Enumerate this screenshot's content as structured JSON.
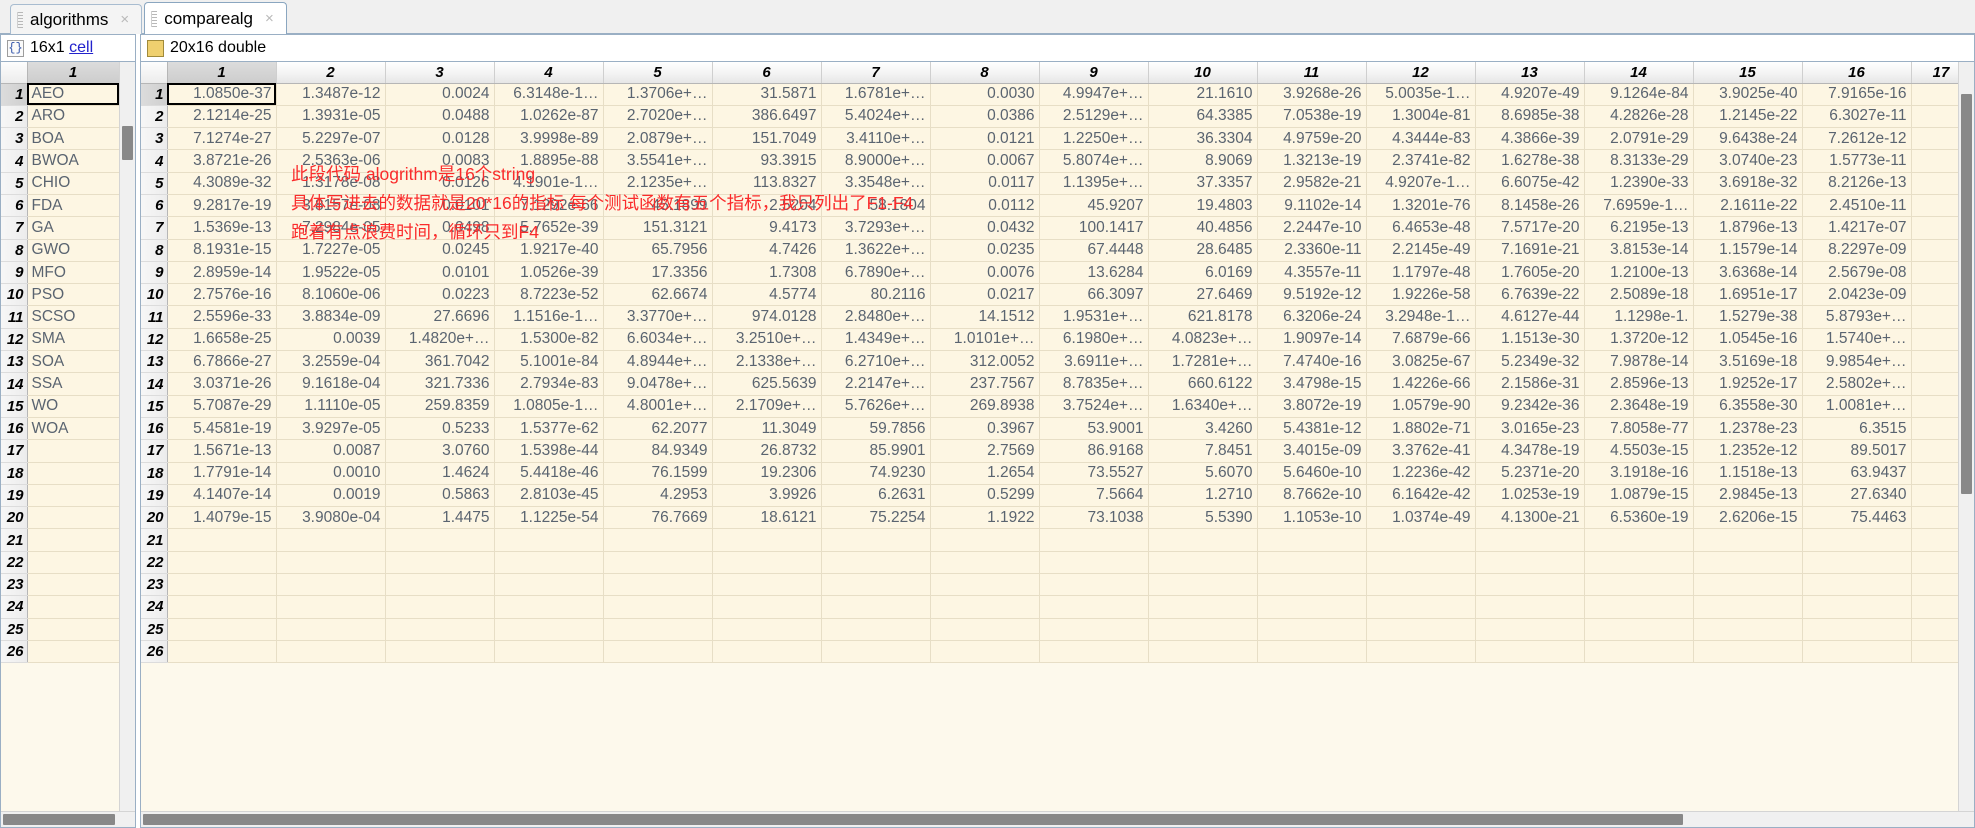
{
  "window": {
    "tabs": [
      {
        "label": "algorithms",
        "active": false,
        "close_icon": "×"
      },
      {
        "label": "comparealg",
        "active": true,
        "close_icon": "×"
      }
    ]
  },
  "left_panel": {
    "icon": "cell-array-icon",
    "icon_glyph": "{}",
    "size_text": "16x1",
    "type_link": "cell",
    "column_header": "1",
    "row_headers": [
      "1",
      "2",
      "3",
      "4",
      "5",
      "6",
      "7",
      "8",
      "9",
      "10",
      "11",
      "12",
      "13",
      "14",
      "15",
      "16",
      "17",
      "18",
      "19",
      "20",
      "21",
      "22",
      "23",
      "24",
      "25",
      "26"
    ],
    "values": [
      "AEO",
      "ARO",
      "BOA",
      "BWOA",
      "CHIO",
      "FDA",
      "GA",
      "GWO",
      "MFO",
      "PSO",
      "SCSO",
      "SMA",
      "SOA",
      "SSA",
      "WO",
      "WOA",
      "",
      "",
      "",
      "",
      "",
      "",
      "",
      "",
      "",
      ""
    ],
    "selected_row": 1,
    "selected_col": 1
  },
  "right_panel": {
    "icon": "matrix-icon",
    "size_text": "20x16 double",
    "column_headers": [
      "1",
      "2",
      "3",
      "4",
      "5",
      "6",
      "7",
      "8",
      "9",
      "10",
      "11",
      "12",
      "13",
      "14",
      "15",
      "16",
      "17"
    ],
    "row_headers": [
      "1",
      "2",
      "3",
      "4",
      "5",
      "6",
      "7",
      "8",
      "9",
      "10",
      "11",
      "12",
      "13",
      "14",
      "15",
      "16",
      "17",
      "18",
      "19",
      "20",
      "21",
      "22",
      "23",
      "24",
      "25",
      "26"
    ],
    "selected_row": 1,
    "selected_col": 1,
    "rows": [
      [
        "1.0850e-37",
        "1.3487e-12",
        "0.0024",
        "6.3148e-1…",
        "1.3706e+…",
        "31.5871",
        "1.6781e+…",
        "0.0030",
        "4.9947e+…",
        "21.1610",
        "3.9268e-26",
        "5.0035e-1…",
        "4.9207e-49",
        "9.1264e-84",
        "3.9025e-40",
        "7.9165e-16",
        ""
      ],
      [
        "2.1214e-25",
        "1.3931e-05",
        "0.0488",
        "1.0262e-87",
        "2.7020e+…",
        "386.6497",
        "5.4024e+…",
        "0.0386",
        "2.5129e+…",
        "64.3385",
        "7.0538e-19",
        "1.3004e-81",
        "8.6985e-38",
        "4.2826e-28",
        "1.2145e-22",
        "6.3027e-11",
        ""
      ],
      [
        "7.1274e-27",
        "5.2297e-07",
        "0.0128",
        "3.9998e-89",
        "2.0879e+…",
        "151.7049",
        "3.4110e+…",
        "0.0121",
        "1.2250e+…",
        "36.3304",
        "4.9759e-20",
        "4.3444e-83",
        "4.3866e-39",
        "2.0791e-29",
        "9.6438e-24",
        "7.2612e-12",
        ""
      ],
      [
        "3.8721e-26",
        "2.5363e-06",
        "0.0083",
        "1.8895e-88",
        "3.5541e+…",
        "93.3915",
        "8.9000e+…",
        "0.0067",
        "5.8074e+…",
        "8.9069",
        "1.3213e-19",
        "2.3741e-82",
        "1.6278e-38",
        "8.3133e-29",
        "3.0740e-23",
        "1.5773e-11",
        ""
      ],
      [
        "4.3089e-32",
        "1.3178e-08",
        "0.0126",
        "4.1901e-1…",
        "2.1235e+…",
        "113.8327",
        "3.3548e+…",
        "0.0117",
        "1.1395e+…",
        "37.3357",
        "2.9582e-21",
        "4.9207e-1…",
        "6.6075e-42",
        "1.2390e-33",
        "3.6918e-32",
        "8.2126e-13",
        ""
      ],
      [
        "9.2817e-19",
        "3.8157e-08",
        "0.0101",
        "7.1292e-66",
        "45.1899",
        "2.5204",
        "58.1804",
        "0.0112",
        "45.9207",
        "19.4803",
        "9.1102e-14",
        "1.3201e-76",
        "8.1458e-26",
        "7.6959e-1…",
        "2.1611e-22",
        "2.4510e-11",
        ""
      ],
      [
        "1.5369e-13",
        "7.2984e-05",
        "0.0498",
        "5.7652e-39",
        "151.3121",
        "9.4173",
        "3.7293e+…",
        "0.0432",
        "100.1417",
        "40.4856",
        "2.2447e-10",
        "6.4653e-48",
        "7.5717e-20",
        "6.2195e-13",
        "1.8796e-13",
        "1.4217e-07",
        ""
      ],
      [
        "8.1931e-15",
        "1.7227e-05",
        "0.0245",
        "1.9217e-40",
        "65.7956",
        "4.7426",
        "1.3622e+…",
        "0.0235",
        "67.4448",
        "28.6485",
        "2.3360e-11",
        "2.2145e-49",
        "7.1691e-21",
        "3.8153e-14",
        "1.1579e-14",
        "8.2297e-09",
        ""
      ],
      [
        "2.8959e-14",
        "1.9522e-05",
        "0.0101",
        "1.0526e-39",
        "17.3356",
        "1.7308",
        "6.7890e+…",
        "0.0076",
        "13.6284",
        "6.0169",
        "4.3557e-11",
        "1.1797e-48",
        "1.7605e-20",
        "1.2100e-13",
        "3.6368e-14",
        "2.5679e-08",
        ""
      ],
      [
        "2.7576e-16",
        "8.1060e-06",
        "0.0223",
        "8.7223e-52",
        "62.6674",
        "4.5774",
        "80.2116",
        "0.0217",
        "66.3097",
        "27.6469",
        "9.5192e-12",
        "1.9226e-58",
        "6.7639e-22",
        "2.5089e-18",
        "1.6951e-17",
        "2.0423e-09",
        ""
      ],
      [
        "2.5596e-33",
        "3.8834e-09",
        "27.6696",
        "1.1516e-1…",
        "3.3770e+…",
        "974.0128",
        "2.8480e+…",
        "14.1512",
        "1.9531e+…",
        "621.8178",
        "6.3206e-24",
        "3.2948e-1…",
        "4.6127e-44",
        "1.1298e-1.",
        "1.5279e-38",
        "5.8793e+…",
        ""
      ],
      [
        "1.6658e-25",
        "0.0039",
        "1.4820e+…",
        "1.5300e-82",
        "6.6034e+…",
        "3.2510e+…",
        "1.4349e+…",
        "1.0101e+…",
        "6.1980e+…",
        "4.0823e+…",
        "1.9097e-14",
        "7.6879e-66",
        "1.1513e-30",
        "1.3720e-12",
        "1.0545e-16",
        "1.5740e+…",
        ""
      ],
      [
        "6.7866e-27",
        "3.2559e-04",
        "361.7042",
        "5.1001e-84",
        "4.8944e+…",
        "2.1338e+…",
        "6.2710e+…",
        "312.0052",
        "3.6911e+…",
        "1.7281e+…",
        "7.4740e-16",
        "3.0825e-67",
        "5.2349e-32",
        "7.9878e-14",
        "3.5169e-18",
        "9.9854e+…",
        ""
      ],
      [
        "3.0371e-26",
        "9.1618e-04",
        "321.7336",
        "2.7934e-83",
        "9.0478e+…",
        "625.5639",
        "2.2147e+…",
        "237.7567",
        "8.7835e+…",
        "660.6122",
        "3.4798e-15",
        "1.4226e-66",
        "2.1586e-31",
        "2.8596e-13",
        "1.9252e-17",
        "2.5802e+…",
        ""
      ],
      [
        "5.7087e-29",
        "1.1110e-05",
        "259.8359",
        "1.0805e-1…",
        "4.8001e+…",
        "2.1709e+…",
        "5.7626e+…",
        "269.8938",
        "3.7524e+…",
        "1.6340e+…",
        "3.8072e-19",
        "1.0579e-90",
        "9.2342e-36",
        "2.3648e-19",
        "6.3558e-30",
        "1.0081e+…",
        ""
      ],
      [
        "5.4581e-19",
        "3.9297e-05",
        "0.5233",
        "1.5377e-62",
        "62.2077",
        "11.3049",
        "59.7856",
        "0.3967",
        "53.9001",
        "3.4260",
        "5.4381e-12",
        "1.8802e-71",
        "3.0165e-23",
        "7.8058e-77",
        "1.2378e-23",
        "6.3515",
        ""
      ],
      [
        "1.5671e-13",
        "0.0087",
        "3.0760",
        "1.5398e-44",
        "84.9349",
        "26.8732",
        "85.9901",
        "2.7569",
        "86.9168",
        "7.8451",
        "3.4015e-09",
        "3.3762e-41",
        "4.3478e-19",
        "4.5503e-15",
        "1.2352e-12",
        "89.5017",
        ""
      ],
      [
        "1.7791e-14",
        "0.0010",
        "1.4624",
        "5.4418e-46",
        "76.1599",
        "19.2306",
        "74.9230",
        "1.2654",
        "73.5527",
        "5.6070",
        "5.6460e-10",
        "1.2236e-42",
        "5.2371e-20",
        "3.1918e-16",
        "1.1518e-13",
        "63.9437",
        ""
      ],
      [
        "4.1407e-14",
        "0.0019",
        "0.5863",
        "2.8103e-45",
        "4.2953",
        "3.9926",
        "6.2631",
        "0.5299",
        "7.5664",
        "1.2710",
        "8.7662e-10",
        "6.1642e-42",
        "1.0253e-19",
        "1.0879e-15",
        "2.9845e-13",
        "27.6340",
        ""
      ],
      [
        "1.4079e-15",
        "3.9080e-04",
        "1.4475",
        "1.1225e-54",
        "76.7669",
        "18.6121",
        "75.2254",
        "1.1922",
        "73.1038",
        "5.5390",
        "1.1053e-10",
        "1.0374e-49",
        "4.1300e-21",
        "6.5360e-19",
        "2.6206e-15",
        "75.4463",
        ""
      ]
    ],
    "annotations": [
      "此段代码 alogrithm是16个string",
      "具体写进去的数据就是20*16的指标 每个测试函数有五个指标，我只列出了F1-F4",
      "跑着有点浪费时间，循环只到F4"
    ]
  },
  "colors": {
    "cell_background": "#fdf6e3",
    "annotation": "#fa2b2b",
    "link": "#2222cc",
    "grid_line": "#e7dec6",
    "panel_border": "#9aafc4"
  }
}
